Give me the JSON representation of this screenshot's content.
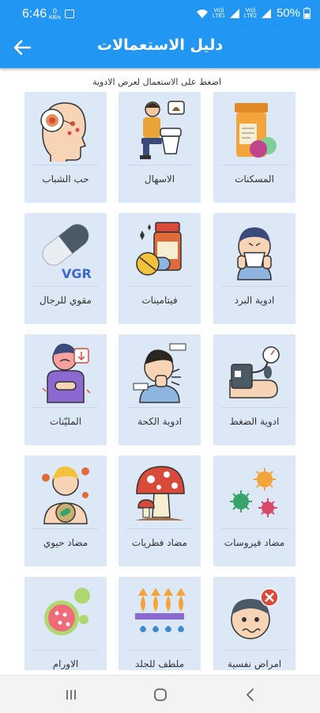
{
  "status_bar": {
    "time": "6:46",
    "net_speed_value": "0",
    "net_speed_unit": "KB/s",
    "lte1": "Vo)) LTE1",
    "lte2": "Vo)) LTE2",
    "battery": "50%"
  },
  "app_bar": {
    "title": "دليل الاستعمالات",
    "back_icon": "arrow-left-icon"
  },
  "hint": "اضغط على الاستعمال لعرض الادوية",
  "colors": {
    "primary": "#2196f3",
    "card_bg": "#dce8f6"
  },
  "categories": [
    {
      "label": "المسكنات",
      "icon": "pill-bottle-icon"
    },
    {
      "label": "الاسهال",
      "icon": "toilet-person-icon"
    },
    {
      "label": "حب الشباب",
      "icon": "acne-face-icon"
    },
    {
      "label": "ادوية البرد",
      "icon": "sneezing-person-icon"
    },
    {
      "label": "فيتامينات",
      "icon": "vitamins-icon"
    },
    {
      "label": "مقوي للرجال",
      "icon": "capsule-vgr-icon"
    },
    {
      "label": "ادوية الضغط",
      "icon": "blood-pressure-icon"
    },
    {
      "label": "ادوية الكحة",
      "icon": "coughing-person-icon"
    },
    {
      "label": "المليّنات",
      "icon": "stomach-ache-icon"
    },
    {
      "label": "مضاد فيروسات",
      "icon": "virus-icon"
    },
    {
      "label": "مضاد فطريات",
      "icon": "mushroom-icon"
    },
    {
      "label": "مضاد حيوي",
      "icon": "bacteria-body-icon"
    },
    {
      "label": "امراض نفسية",
      "icon": "stressed-face-icon"
    },
    {
      "label": "ملطف للجلد",
      "icon": "skin-layers-icon"
    },
    {
      "label": "الاورام",
      "icon": "tumor-cell-icon"
    }
  ],
  "nav_bar": {
    "recents_icon": "recents-icon",
    "home_icon": "home-icon",
    "back_icon": "back-chevron-icon"
  }
}
